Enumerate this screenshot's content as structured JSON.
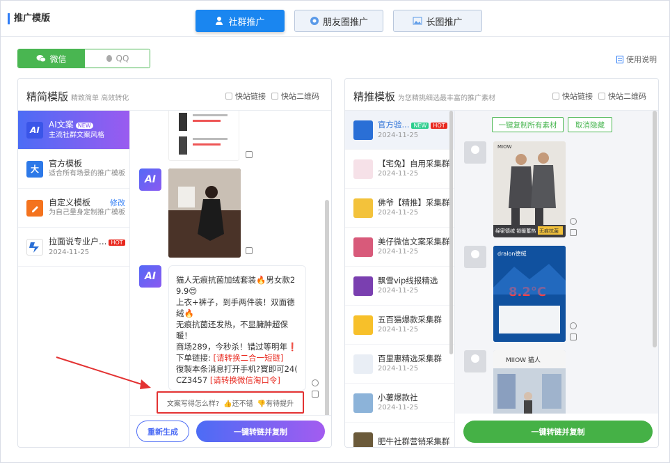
{
  "page_title": "推广模版",
  "tabs": [
    {
      "label": "社群推广",
      "icon": "group-icon"
    },
    {
      "label": "朋友圈推广",
      "icon": "moments-icon"
    },
    {
      "label": "长图推广",
      "icon": "image-icon"
    }
  ],
  "platforms": [
    {
      "label": "微信"
    },
    {
      "label": "QQ"
    }
  ],
  "help_label": "使用说明",
  "left_panel": {
    "title": "精简模版",
    "subtitle": "精致简单 高效转化",
    "checks": [
      "快站链接",
      "快站二维码"
    ],
    "nav": [
      {
        "title": "AI文案",
        "badge": "NEW",
        "sub": "主流社群文案风格"
      },
      {
        "title": "官方模板",
        "sub": "适合所有场景的推广模板"
      },
      {
        "title": "自定义模板",
        "sub": "为自己量身定制推广模板",
        "edit": "修改"
      },
      {
        "title": "拉面说专业户...",
        "badge": "HOT",
        "sub": "2024-11-25"
      }
    ],
    "message_lines": [
      "猫人无痕抗菌加绒套装🔥男女款2",
      "9.9😍",
      "上衣+裤子，到手两件装！双面德",
      "绒🔥",
      "无痕抗菌还发热，不显臃肿超保",
      "暖！",
      "商场289，今秒杀！错过等明年❗",
      "下单链接: ",
      "復製本条消息打开手机?寳即可24(",
      "CZ3457 "
    ],
    "link1": "[请转换二合一短链]",
    "link2": "[请转换微信淘口令]",
    "feedback": {
      "question": "文案写得怎么样?",
      "good": "还不错",
      "bad": "有待提升"
    },
    "regen_label": "重新生成",
    "convert_label": "一键转链并复制"
  },
  "right_panel": {
    "title": "精推模板",
    "subtitle": "为您精挑细选最丰富的推广素材",
    "checks": [
      "快站链接",
      "快站二维码"
    ],
    "groups": [
      {
        "name": "官方验...",
        "date": "2024-11-25",
        "badges": [
          "NEW",
          "HOT"
        ]
      },
      {
        "name": "【宅兔】自用采集群",
        "date": "2024-11-25"
      },
      {
        "name": "佛爷【精推】采集群",
        "date": "2024-11-25"
      },
      {
        "name": "美仔微信文案采集群",
        "date": "2024-11-25"
      },
      {
        "name": "飘雪vip线报精选",
        "date": "2024-11-25"
      },
      {
        "name": "五百猫爆款采集群",
        "date": "2024-11-25"
      },
      {
        "name": "百里惠精选采集群",
        "date": "2024-11-25"
      },
      {
        "name": "小薯爆款社",
        "date": "2024-11-25"
      },
      {
        "name": "肥牛社群营销采集群",
        "date": ""
      }
    ],
    "copy_all_label": "一键复制所有素材",
    "cancel_hide_label": "取消隐藏",
    "posts": [
      {
        "brand": "MIOW",
        "caption1": "绵密德绒 锁暖蓄热",
        "caption2": "无痕抗菌"
      },
      {
        "brand": "dralon德绒",
        "temp": "8.2°C"
      },
      {
        "brand": "MIIOW 猫人"
      }
    ],
    "convert_label": "一键转链并复制"
  }
}
